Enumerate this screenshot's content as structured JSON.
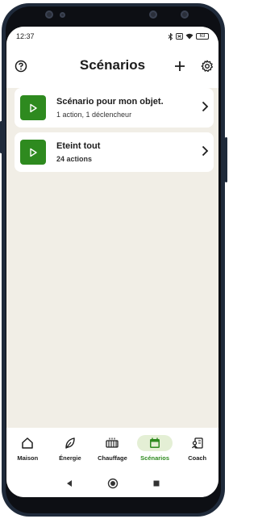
{
  "status": {
    "time": "12:37",
    "battery": "63"
  },
  "header": {
    "title": "Scénarios",
    "help_icon": "help-circle-icon",
    "add_icon": "plus-icon",
    "settings_icon": "gear-icon"
  },
  "scenarios": [
    {
      "title": "Scénario pour mon objet.",
      "subtitle": "1 action, 1 déclencheur"
    },
    {
      "title": "Eteint tout",
      "subtitle": "24 actions"
    }
  ],
  "tabs": [
    {
      "label": "Maison",
      "icon": "house-icon"
    },
    {
      "label": "Énergie",
      "icon": "leaf-icon"
    },
    {
      "label": "Chauffage",
      "icon": "radiator-icon"
    },
    {
      "label": "Scénarios",
      "icon": "calendar-icon"
    },
    {
      "label": "Coach",
      "icon": "coach-icon"
    }
  ],
  "colors": {
    "accent": "#2e8a1f",
    "background": "#f1eee6",
    "active_tab_bg": "#e4efd5"
  }
}
